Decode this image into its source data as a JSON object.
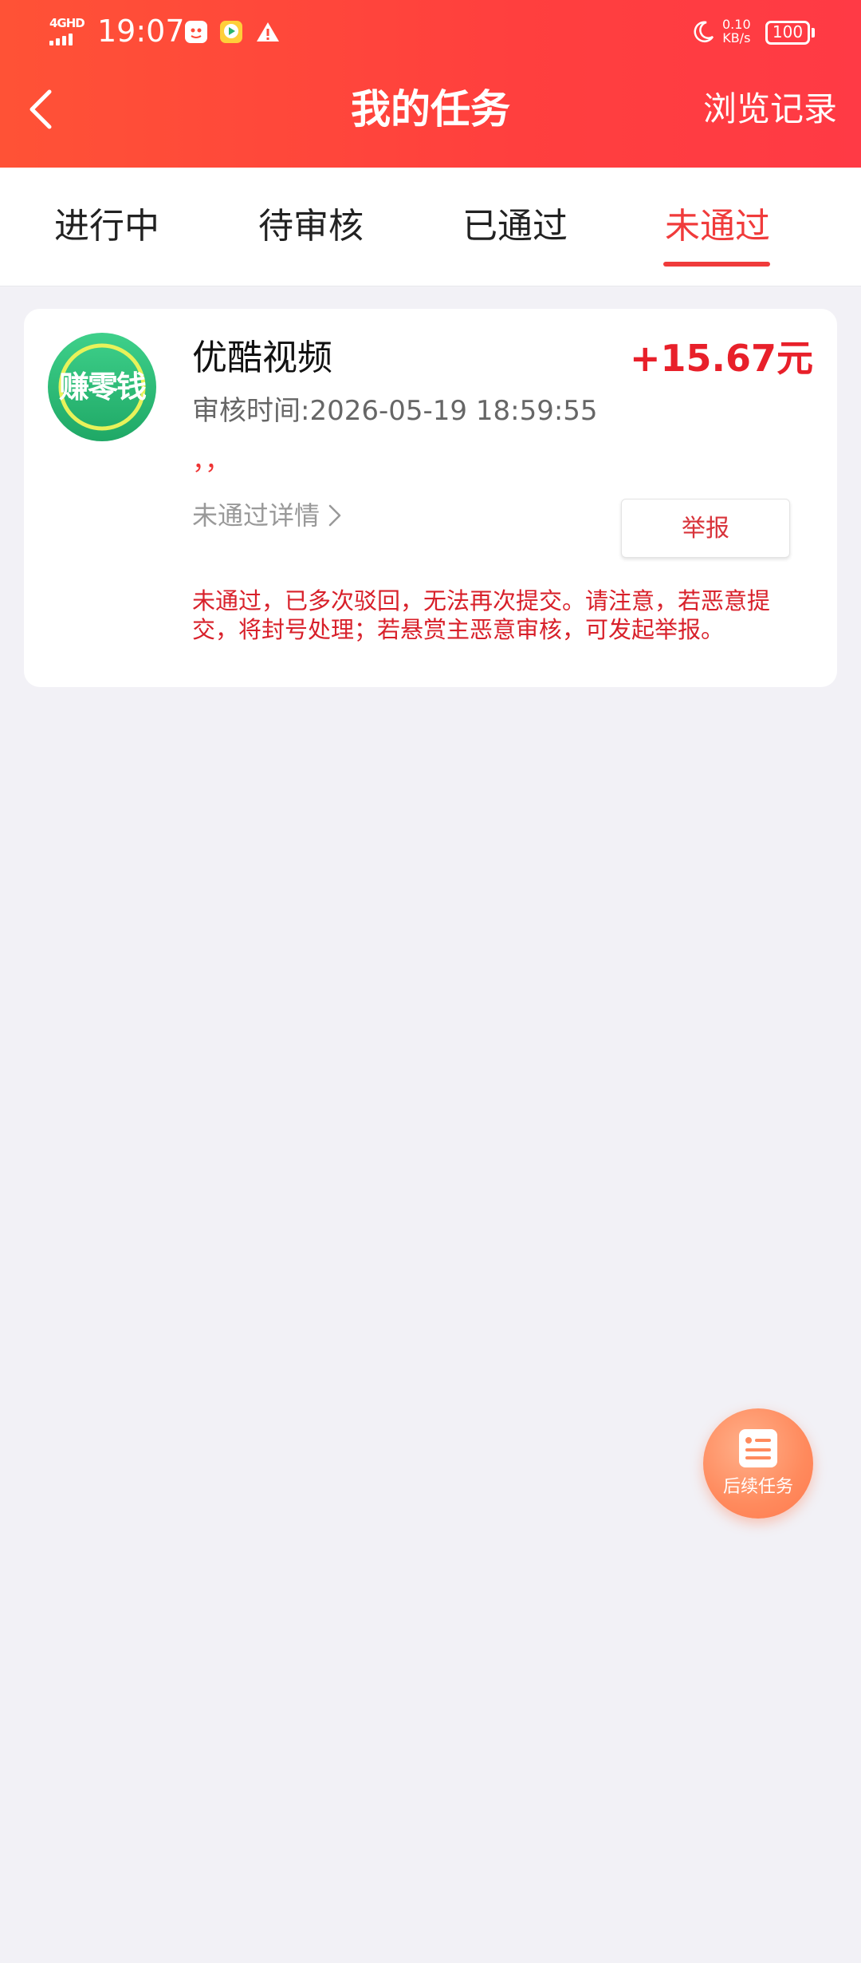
{
  "status_bar": {
    "network": "4GHD",
    "time": "19:07",
    "speed_value": "0.10",
    "speed_unit": "KB/s",
    "battery": "100"
  },
  "header": {
    "title": "我的任务",
    "history_label": "浏览记录"
  },
  "tabs": [
    {
      "label": "进行中",
      "active": false
    },
    {
      "label": "待审核",
      "active": false
    },
    {
      "label": "已通过",
      "active": false
    },
    {
      "label": "未通过",
      "active": true
    }
  ],
  "task": {
    "logo_text": "赚零钱",
    "name": "优酷视频",
    "reward": "+15.67元",
    "review_time": "审核时间:2026-05-19 18:59:55",
    "remark": "，，",
    "detail_label": "未通过详情",
    "report_label": "举报",
    "notice": "未通过，已多次驳回，无法再次提交。请注意，若恶意提交，将封号处理；若悬赏主恶意审核，可发起举报。"
  },
  "fab": {
    "label": "后续任务"
  },
  "colors": {
    "header_start": "#ff5236",
    "header_end": "#ff3a45",
    "accent_red": "#f03b3b",
    "reward_red": "#e8202a",
    "background": "#f2f1f6",
    "fab_orange": "#ff8a5d",
    "logo_green": "#2dbf7a"
  },
  "icons": {
    "back": "chevron-left-icon",
    "detail": "chevron-right-icon",
    "fab": "task-list-icon",
    "moon": "moon-icon",
    "warning": "warning-icon"
  }
}
